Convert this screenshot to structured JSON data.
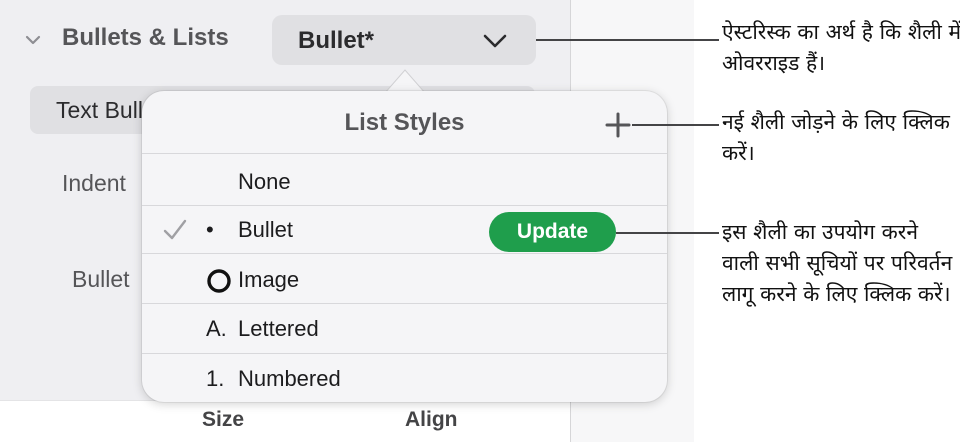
{
  "sidebar": {
    "section_title": "Bullets & Lists",
    "style_dropdown_value": "Bullet*",
    "text_bullets_label": "Text Bullets",
    "indent_label": "Indent",
    "bullet_label": "Bullet",
    "size_label": "Size",
    "align_label": "Align"
  },
  "popover": {
    "title": "List Styles",
    "add_icon": "plus-icon",
    "items": [
      {
        "marker": "",
        "label": "None",
        "checked": false
      },
      {
        "marker": "•",
        "label": "Bullet",
        "checked": true,
        "action": "Update"
      },
      {
        "marker": "O",
        "label": "Image",
        "checked": false
      },
      {
        "marker": "A.",
        "label": "Lettered",
        "checked": false
      },
      {
        "marker": "1.",
        "label": "Numbered",
        "checked": false
      }
    ]
  },
  "callouts": {
    "asterisk": "ऐस्टरिस्क का अर्थ है कि शैली में ओवरराइड हैं।",
    "add": "नई शैली जोड़ने के लिए क्लिक करें।",
    "update": "इस शैली का उपयोग करने वाली सभी सूचियों पर परिवर्तन लागू करने के लिए क्लिक करें।"
  },
  "colors": {
    "update_button": "#1f9e4c",
    "sidebar_bg": "#efeff2",
    "popover_bg": "#f5f5f7"
  }
}
